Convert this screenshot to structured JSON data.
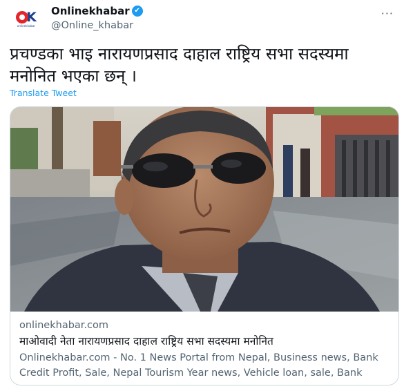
{
  "author": {
    "display_name": "Onlinekhabar",
    "handle": "@Online_khabar",
    "verified_icon": "✔",
    "logo_text": "OK",
    "logo_subtext": "onlinekhabar"
  },
  "more_icon": "···",
  "tweet": {
    "text": "प्रचण्डका भाइ नारायणप्रसाद दाहाल राष्ट्रिय सभा सदस्यमा मनोनित भएका छन् ।",
    "translate_label": "Translate Tweet"
  },
  "card": {
    "domain": "onlinekhabar.com",
    "title": "माओवादी नेता नारायणप्रसाद दाहाल राष्ट्रिय सभा सदस्यमा मनोनित",
    "description": "Onlinekhabar.com - No. 1 News Portal from Nepal, Business news, Bank Credit Profit, Sale, Nepal Tourism Year news, Vehicle loan, sale, Bank"
  },
  "colors": {
    "link": "#1d9bf0",
    "secondary_text": "#536471",
    "brand_red": "#e3262b",
    "brand_blue": "#1b3f8f"
  }
}
